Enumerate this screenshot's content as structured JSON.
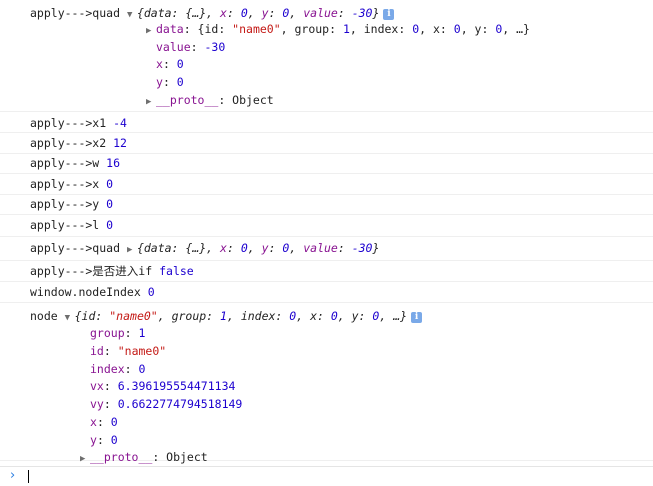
{
  "rows": [
    {
      "lines": [
        [
          {
            "t": "apply--->quad ",
            "c": "plain"
          },
          {
            "t": "▼",
            "c": "arrow"
          },
          {
            "t": "{data: {…}, ",
            "c": "ital plain"
          },
          {
            "t": "x",
            "c": "ital key"
          },
          {
            "t": ": ",
            "c": "ital plain"
          },
          {
            "t": "0",
            "c": "ital num"
          },
          {
            "t": ", ",
            "c": "ital plain"
          },
          {
            "t": "y",
            "c": "ital key"
          },
          {
            "t": ": ",
            "c": "ital plain"
          },
          {
            "t": "0",
            "c": "ital num"
          },
          {
            "t": ", ",
            "c": "ital plain"
          },
          {
            "t": "value",
            "c": "ital key"
          },
          {
            "t": ": ",
            "c": "ital plain"
          },
          {
            "t": "-30",
            "c": "ital num"
          },
          {
            "t": "}",
            "c": "ital plain"
          },
          {
            "t": "i",
            "c": "info-icon"
          }
        ],
        [
          {
            "t": "▶",
            "c": "arrow"
          },
          {
            "t": "data",
            "c": "key"
          },
          {
            "t": ": {id: ",
            "c": "plain"
          },
          {
            "t": "\"name0\"",
            "c": "str"
          },
          {
            "t": ", group: ",
            "c": "plain"
          },
          {
            "t": "1",
            "c": "num"
          },
          {
            "t": ", index: ",
            "c": "plain"
          },
          {
            "t": "0",
            "c": "num"
          },
          {
            "t": ", x: ",
            "c": "plain"
          },
          {
            "t": "0",
            "c": "num"
          },
          {
            "t": ", y: ",
            "c": "plain"
          },
          {
            "t": "0",
            "c": "num"
          },
          {
            "t": ", …}",
            "c": "plain"
          }
        ],
        [
          {
            "t": "value",
            "c": "key"
          },
          {
            "t": ": ",
            "c": "plain"
          },
          {
            "t": "-30",
            "c": "num"
          }
        ],
        [
          {
            "t": "x",
            "c": "key"
          },
          {
            "t": ": ",
            "c": "plain"
          },
          {
            "t": "0",
            "c": "num"
          }
        ],
        [
          {
            "t": "y",
            "c": "key"
          },
          {
            "t": ": ",
            "c": "plain"
          },
          {
            "t": "0",
            "c": "num"
          }
        ],
        [
          {
            "t": "▶",
            "c": "arrow"
          },
          {
            "t": "__proto__",
            "c": "key"
          },
          {
            "t": ": Object",
            "c": "plain"
          }
        ]
      ]
    },
    {
      "lines": [
        [
          {
            "t": "apply--->x1 ",
            "c": "plain"
          },
          {
            "t": "-4",
            "c": "num"
          }
        ]
      ]
    },
    {
      "lines": [
        [
          {
            "t": "apply--->x2 ",
            "c": "plain"
          },
          {
            "t": "12",
            "c": "num"
          }
        ]
      ]
    },
    {
      "lines": [
        [
          {
            "t": "apply--->w ",
            "c": "plain"
          },
          {
            "t": "16",
            "c": "num"
          }
        ]
      ]
    },
    {
      "lines": [
        [
          {
            "t": "apply--->x ",
            "c": "plain"
          },
          {
            "t": "0",
            "c": "num"
          }
        ]
      ]
    },
    {
      "lines": [
        [
          {
            "t": "apply--->y ",
            "c": "plain"
          },
          {
            "t": "0",
            "c": "num"
          }
        ]
      ]
    },
    {
      "lines": [
        [
          {
            "t": "apply--->l ",
            "c": "plain"
          },
          {
            "t": "0",
            "c": "num"
          }
        ]
      ]
    },
    {
      "lines": [
        [
          {
            "t": "apply--->quad ",
            "c": "plain"
          },
          {
            "t": "▶",
            "c": "arrow"
          },
          {
            "t": "{data: {…}, ",
            "c": "ital plain"
          },
          {
            "t": "x",
            "c": "ital key"
          },
          {
            "t": ": ",
            "c": "ital plain"
          },
          {
            "t": "0",
            "c": "ital num"
          },
          {
            "t": ", ",
            "c": "ital plain"
          },
          {
            "t": "y",
            "c": "ital key"
          },
          {
            "t": ": ",
            "c": "ital plain"
          },
          {
            "t": "0",
            "c": "ital num"
          },
          {
            "t": ", ",
            "c": "ital plain"
          },
          {
            "t": "value",
            "c": "ital key"
          },
          {
            "t": ": ",
            "c": "ital plain"
          },
          {
            "t": "-30",
            "c": "ital num"
          },
          {
            "t": "}",
            "c": "ital plain"
          }
        ]
      ]
    },
    {
      "lines": [
        [
          {
            "t": "apply--->是否进入if ",
            "c": "plain"
          },
          {
            "t": "false",
            "c": "num"
          }
        ]
      ]
    },
    {
      "lines": [
        [
          {
            "t": "window.nodeIndex ",
            "c": "plain"
          },
          {
            "t": "0",
            "c": "num"
          }
        ]
      ]
    },
    {
      "lines": [
        [
          {
            "t": "node ",
            "c": "plain"
          },
          {
            "t": "▼",
            "c": "arrow"
          },
          {
            "t": "{id: ",
            "c": "ital plain"
          },
          {
            "t": "\"name0\"",
            "c": "ital str"
          },
          {
            "t": ", group: ",
            "c": "ital plain"
          },
          {
            "t": "1",
            "c": "ital num"
          },
          {
            "t": ", index: ",
            "c": "ital plain"
          },
          {
            "t": "0",
            "c": "ital num"
          },
          {
            "t": ", x: ",
            "c": "ital plain"
          },
          {
            "t": "0",
            "c": "ital num"
          },
          {
            "t": ", y: ",
            "c": "ital plain"
          },
          {
            "t": "0",
            "c": "ital num"
          },
          {
            "t": ", …}",
            "c": "ital plain"
          },
          {
            "t": "i",
            "c": "info-icon"
          }
        ],
        [
          {
            "t": "group",
            "c": "key"
          },
          {
            "t": ": ",
            "c": "plain"
          },
          {
            "t": "1",
            "c": "num"
          }
        ],
        [
          {
            "t": "id",
            "c": "key"
          },
          {
            "t": ": ",
            "c": "plain"
          },
          {
            "t": "\"name0\"",
            "c": "str"
          }
        ],
        [
          {
            "t": "index",
            "c": "key"
          },
          {
            "t": ": ",
            "c": "plain"
          },
          {
            "t": "0",
            "c": "num"
          }
        ],
        [
          {
            "t": "vx",
            "c": "key"
          },
          {
            "t": ": ",
            "c": "plain"
          },
          {
            "t": "6.396195554471134",
            "c": "num"
          }
        ],
        [
          {
            "t": "vy",
            "c": "key"
          },
          {
            "t": ": ",
            "c": "plain"
          },
          {
            "t": "0.6622774794518149",
            "c": "num"
          }
        ],
        [
          {
            "t": "x",
            "c": "key"
          },
          {
            "t": ": ",
            "c": "plain"
          },
          {
            "t": "0",
            "c": "num"
          }
        ],
        [
          {
            "t": "y",
            "c": "key"
          },
          {
            "t": ": ",
            "c": "plain"
          },
          {
            "t": "0",
            "c": "num"
          }
        ],
        [
          {
            "t": "▶",
            "c": "arrow"
          },
          {
            "t": "__proto__",
            "c": "key"
          },
          {
            "t": ": Object",
            "c": "plain"
          }
        ]
      ]
    }
  ],
  "prompt": {
    "chevron": "›"
  },
  "colors": {
    "key": "#881391",
    "number": "#1c00cf",
    "string": "#c41a16",
    "prompt": "#2a7de1"
  }
}
